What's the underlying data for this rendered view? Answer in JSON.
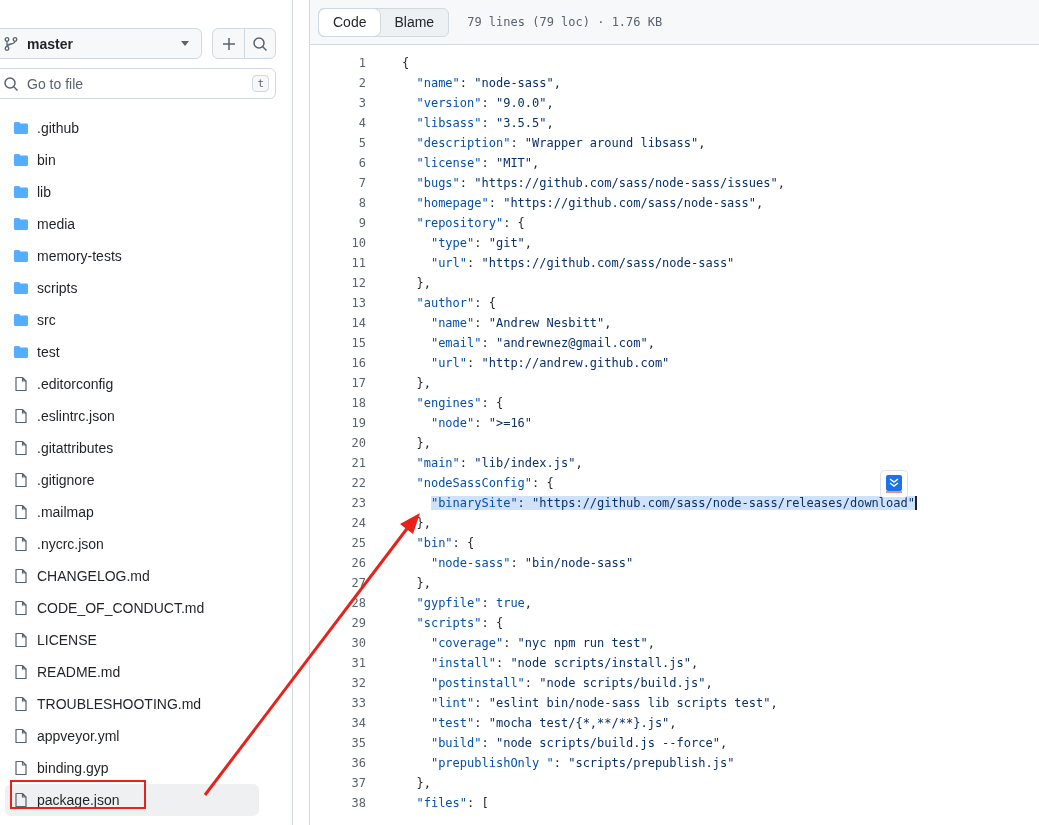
{
  "sidebar": {
    "branch": "master",
    "search": {
      "placeholder": "Go to file",
      "shortcut": "t"
    },
    "items": [
      {
        "kind": "folder",
        "name": ".github",
        "selected": false
      },
      {
        "kind": "folder",
        "name": "bin",
        "selected": false
      },
      {
        "kind": "folder",
        "name": "lib",
        "selected": false
      },
      {
        "kind": "folder",
        "name": "media",
        "selected": false
      },
      {
        "kind": "folder",
        "name": "memory-tests",
        "selected": false
      },
      {
        "kind": "folder",
        "name": "scripts",
        "selected": false
      },
      {
        "kind": "folder",
        "name": "src",
        "selected": false
      },
      {
        "kind": "folder",
        "name": "test",
        "selected": false
      },
      {
        "kind": "file",
        "name": ".editorconfig",
        "selected": false
      },
      {
        "kind": "file",
        "name": ".eslintrc.json",
        "selected": false
      },
      {
        "kind": "file",
        "name": ".gitattributes",
        "selected": false
      },
      {
        "kind": "file",
        "name": ".gitignore",
        "selected": false
      },
      {
        "kind": "file",
        "name": ".mailmap",
        "selected": false
      },
      {
        "kind": "file",
        "name": ".nycrc.json",
        "selected": false
      },
      {
        "kind": "file",
        "name": "CHANGELOG.md",
        "selected": false
      },
      {
        "kind": "file",
        "name": "CODE_OF_CONDUCT.md",
        "selected": false
      },
      {
        "kind": "file",
        "name": "LICENSE",
        "selected": false
      },
      {
        "kind": "file",
        "name": "README.md",
        "selected": false
      },
      {
        "kind": "file",
        "name": "TROUBLESHOOTING.md",
        "selected": false
      },
      {
        "kind": "file",
        "name": "appveyor.yml",
        "selected": false
      },
      {
        "kind": "file",
        "name": "binding.gyp",
        "selected": false
      },
      {
        "kind": "file",
        "name": "package.json",
        "selected": true
      }
    ]
  },
  "file_view": {
    "tabs": [
      {
        "label": "Code",
        "selected": true
      },
      {
        "label": "Blame",
        "selected": false
      }
    ],
    "info": "79 lines (79 loc) · 1.76 KB",
    "lines": [
      {
        "number": "1",
        "text": "{",
        "highlighted": false
      },
      {
        "number": "2",
        "text": "  \"name\": \"node-sass\",",
        "highlighted": false
      },
      {
        "number": "3",
        "text": "  \"version\": \"9.0.0\",",
        "highlighted": false
      },
      {
        "number": "4",
        "text": "  \"libsass\": \"3.5.5\",",
        "highlighted": false
      },
      {
        "number": "5",
        "text": "  \"description\": \"Wrapper around libsass\",",
        "highlighted": false
      },
      {
        "number": "6",
        "text": "  \"license\": \"MIT\",",
        "highlighted": false
      },
      {
        "number": "7",
        "text": "  \"bugs\": \"https://github.com/sass/node-sass/issues\",",
        "highlighted": false
      },
      {
        "number": "8",
        "text": "  \"homepage\": \"https://github.com/sass/node-sass\",",
        "highlighted": false
      },
      {
        "number": "9",
        "text": "  \"repository\": {",
        "highlighted": false
      },
      {
        "number": "10",
        "text": "    \"type\": \"git\",",
        "highlighted": false
      },
      {
        "number": "11",
        "text": "    \"url\": \"https://github.com/sass/node-sass\"",
        "highlighted": false
      },
      {
        "number": "12",
        "text": "  },",
        "highlighted": false
      },
      {
        "number": "13",
        "text": "  \"author\": {",
        "highlighted": false
      },
      {
        "number": "14",
        "text": "    \"name\": \"Andrew Nesbitt\",",
        "highlighted": false
      },
      {
        "number": "15",
        "text": "    \"email\": \"andrewnez@gmail.com\",",
        "highlighted": false
      },
      {
        "number": "16",
        "text": "    \"url\": \"http://andrew.github.com\"",
        "highlighted": false
      },
      {
        "number": "17",
        "text": "  },",
        "highlighted": false
      },
      {
        "number": "18",
        "text": "  \"engines\": {",
        "highlighted": false
      },
      {
        "number": "19",
        "text": "    \"node\": \">=16\"",
        "highlighted": false
      },
      {
        "number": "20",
        "text": "  },",
        "highlighted": false
      },
      {
        "number": "21",
        "text": "  \"main\": \"lib/index.js\",",
        "highlighted": false
      },
      {
        "number": "22",
        "text": "  \"nodeSassConfig\": {",
        "highlighted": false
      },
      {
        "number": "23",
        "text": "    \"binarySite\": \"https://github.com/sass/node-sass/releases/download\"",
        "highlighted": true
      },
      {
        "number": "24",
        "text": "  },",
        "highlighted": false
      },
      {
        "number": "25",
        "text": "  \"bin\": {",
        "highlighted": false
      },
      {
        "number": "26",
        "text": "    \"node-sass\": \"bin/node-sass\"",
        "highlighted": false
      },
      {
        "number": "27",
        "text": "  },",
        "highlighted": false
      },
      {
        "number": "28",
        "text": "  \"gypfile\": true,",
        "highlighted": false
      },
      {
        "number": "29",
        "text": "  \"scripts\": {",
        "highlighted": false
      },
      {
        "number": "30",
        "text": "    \"coverage\": \"nyc npm run test\",",
        "highlighted": false
      },
      {
        "number": "31",
        "text": "    \"install\": \"node scripts/install.js\",",
        "highlighted": false
      },
      {
        "number": "32",
        "text": "    \"postinstall\": \"node scripts/build.js\",",
        "highlighted": false
      },
      {
        "number": "33",
        "text": "    \"lint\": \"eslint bin/node-sass lib scripts test\",",
        "highlighted": false
      },
      {
        "number": "34",
        "text": "    \"test\": \"mocha test/{*,**/**}.js\",",
        "highlighted": false
      },
      {
        "number": "35",
        "text": "    \"build\": \"node scripts/build.js --force\",",
        "highlighted": false
      },
      {
        "number": "36",
        "text": "    \"prepublishOnly \": \"scripts/prepublish.js\"",
        "highlighted": false
      },
      {
        "number": "37",
        "text": "  },",
        "highlighted": false
      },
      {
        "number": "38",
        "text": "  \"files\": [",
        "highlighted": false
      }
    ]
  }
}
